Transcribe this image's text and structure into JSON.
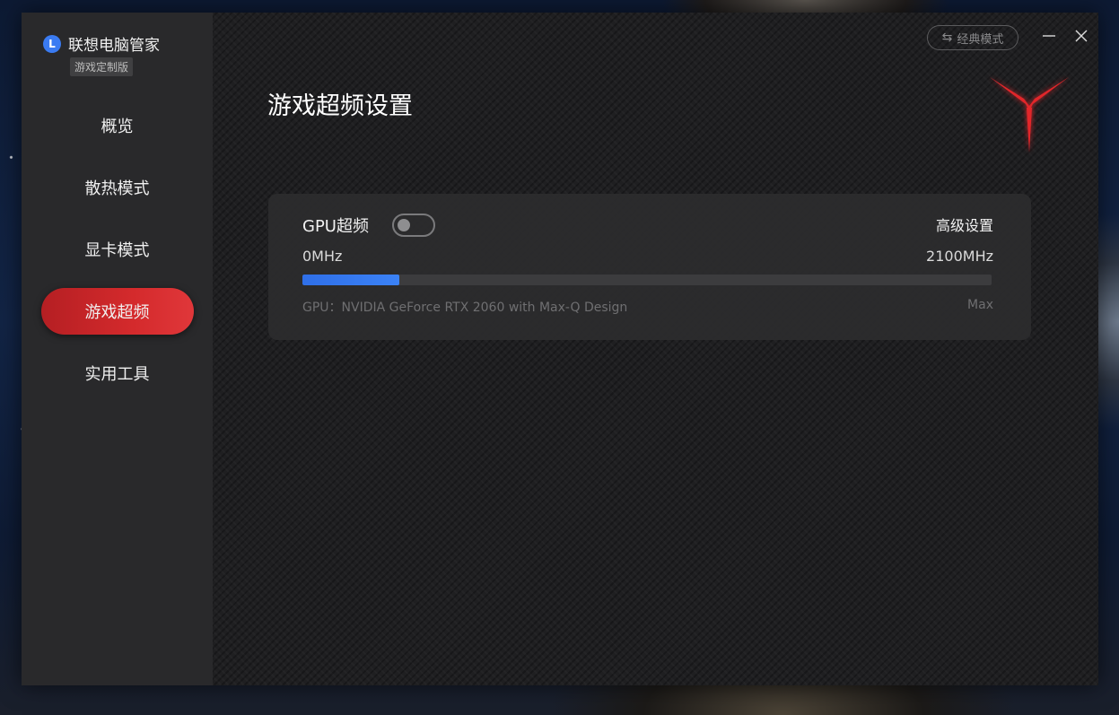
{
  "app": {
    "brand_letter": "L",
    "brand_name": "联想电脑管家",
    "edition": "游戏定制版",
    "accent_color": "#d42a2c",
    "progress_color": "#2f6fe8"
  },
  "sidebar": {
    "items": [
      {
        "label": "概览",
        "active": false
      },
      {
        "label": "散热模式",
        "active": false
      },
      {
        "label": "显卡模式",
        "active": false
      },
      {
        "label": "游戏超频",
        "active": true
      },
      {
        "label": "实用工具",
        "active": false
      }
    ]
  },
  "header": {
    "mode_button_label": "经典模式",
    "mode_icon": "swap-icon",
    "minimize_icon": "minimize-icon",
    "close_icon": "close-icon"
  },
  "main": {
    "title": "游戏超频设置",
    "logo_icon": "legion-y-logo",
    "card": {
      "gpu_label": "GPU超频",
      "toggle_on": false,
      "advanced_label": "高级设置",
      "min_label": "0MHz",
      "max_label": "2100MHz",
      "progress_fraction": 0.14,
      "gpu_info": "GPU：NVIDIA GeForce RTX 2060 with Max-Q Design",
      "max_tag": "Max"
    }
  }
}
